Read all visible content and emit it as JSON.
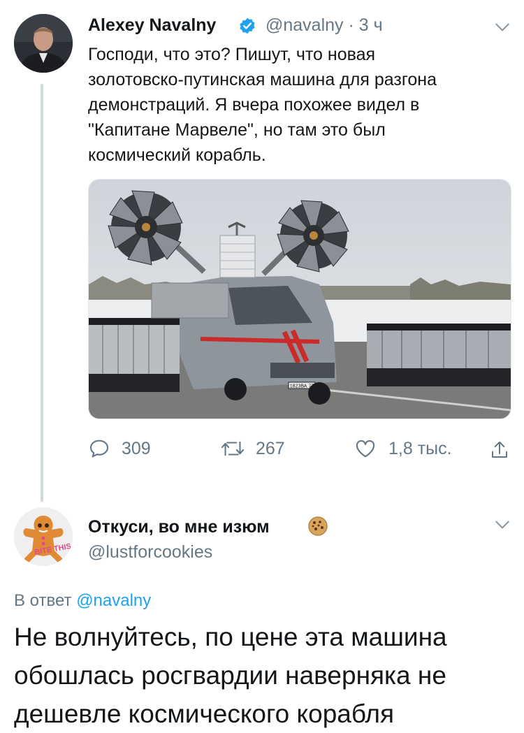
{
  "tweet": {
    "author_name": "Alexey Navalny",
    "handle": "@navalny",
    "separator": "·",
    "time": "3 ч",
    "text": "Господи, что это? Пишут, что новая\nзолотовско-путинская машина для разгона\nдемонстраций. Я вчера похожее видел в\n\"Капитане Марвеле\", но там это был\nкосмический корабль.",
    "plate_text": "1823ВА 77",
    "stats": {
      "replies": "309",
      "retweets": "267",
      "likes": "1,8 тыс."
    }
  },
  "reply": {
    "author_name": "Откуси, во мне изюм",
    "handle": "@lustforcookies",
    "avatar_text": "BITE THIS",
    "in_reply_prefix": "В ответ",
    "in_reply_handle": "@navalny",
    "text": "Не волнуйтесь, по цене эта машина\nобошлась росгвардии наверняка не\nдешевле космического корабля"
  },
  "colors": {
    "verified": "#1da1f2",
    "secondary_text": "#657786",
    "link": "#1da1f2",
    "van_stripe": "#d0302a"
  },
  "icons": {
    "verified": "verified-badge-icon",
    "more": "chevron-down-icon",
    "reply": "reply-icon",
    "retweet": "retweet-icon",
    "like": "heart-icon",
    "share": "share-icon",
    "cookie": "cookie-emoji-icon"
  }
}
